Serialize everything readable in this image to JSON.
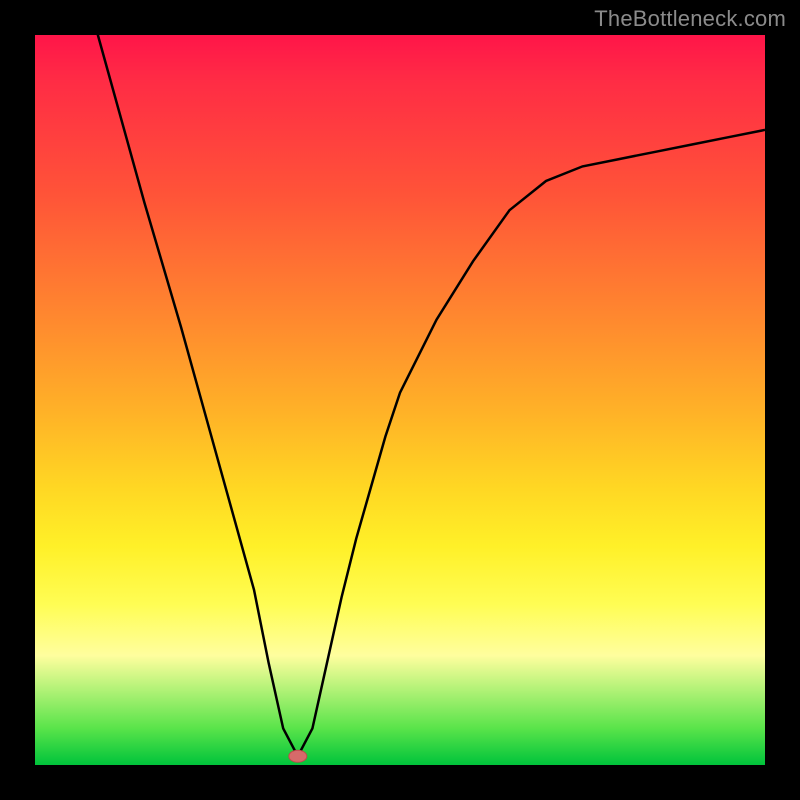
{
  "watermark": "TheBottleneck.com",
  "chart_data": {
    "type": "line",
    "title": "",
    "xlabel": "",
    "ylabel": "",
    "xlim": [
      0,
      1
    ],
    "ylim": [
      0,
      1
    ],
    "x": [
      0.0,
      0.05,
      0.1,
      0.15,
      0.2,
      0.25,
      0.3,
      0.32,
      0.34,
      0.36,
      0.38,
      0.4,
      0.42,
      0.44,
      0.46,
      0.48,
      0.5,
      0.55,
      0.6,
      0.65,
      0.7,
      0.75,
      0.8,
      0.85,
      0.9,
      0.95,
      1.0
    ],
    "values": [
      1.32,
      1.13,
      0.95,
      0.77,
      0.6,
      0.42,
      0.24,
      0.14,
      0.05,
      0.012,
      0.05,
      0.14,
      0.23,
      0.31,
      0.38,
      0.45,
      0.51,
      0.61,
      0.69,
      0.76,
      0.8,
      0.82,
      0.83,
      0.84,
      0.85,
      0.86,
      0.87
    ],
    "marker": {
      "x": 0.36,
      "y": 0.012
    },
    "background_gradient": {
      "top": "#ff1549",
      "mid1": "#ff8c2e",
      "mid2": "#fff028",
      "band": "#59e44a",
      "bottom": "#00c33b"
    }
  }
}
